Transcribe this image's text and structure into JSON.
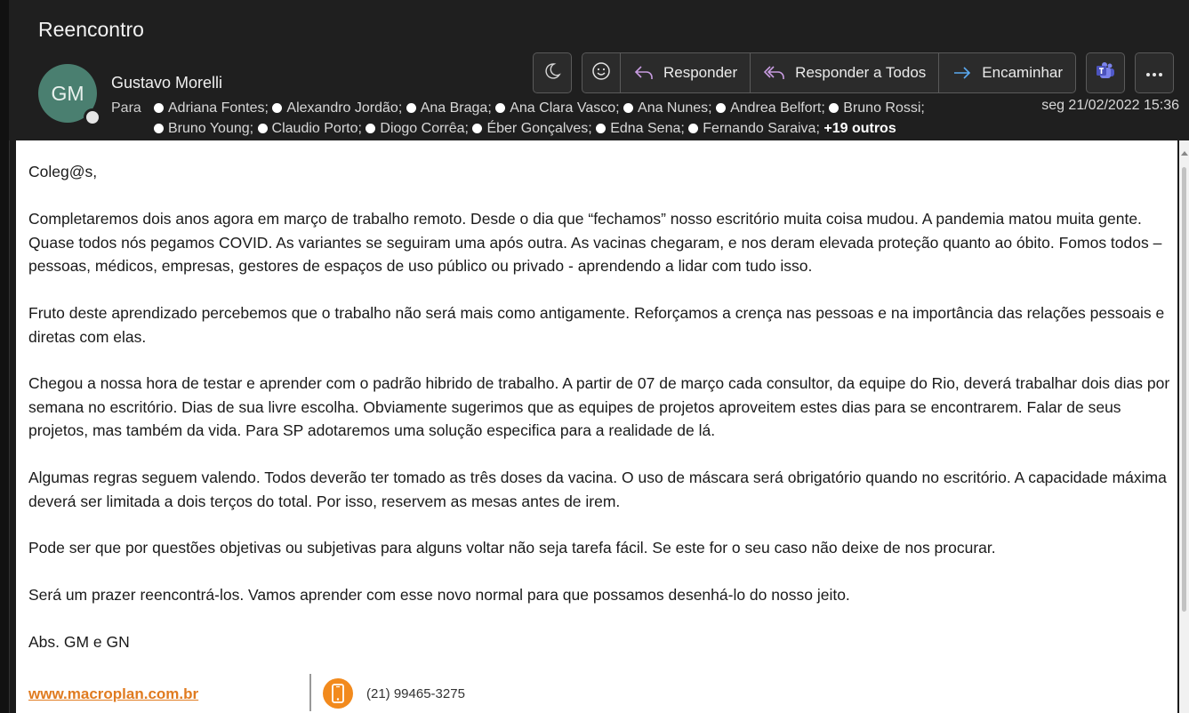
{
  "message": {
    "subject": "Reencontro",
    "avatar_initials": "GM",
    "sender": "Gustavo Morelli",
    "to_label": "Para",
    "recipients_line1": [
      "Adriana Fontes;",
      "Alexandro Jordão;",
      "Ana Braga;",
      "Ana Clara Vasco;",
      "Ana Nunes;",
      "Andrea Belfort;",
      "Bruno Rossi;"
    ],
    "recipients_line2": [
      "Bruno Young;",
      "Claudio Porto;",
      "Diogo Corrêa;",
      "Éber Gonçalves;",
      "Edna Sena;",
      "Fernando Saraiva;"
    ],
    "more_recipients": "+19 outros",
    "date": "seg 21/02/2022 15:36"
  },
  "toolbar": {
    "reply": "Responder",
    "reply_all": "Responder a Todos",
    "forward": "Encaminhar",
    "icons": [
      "moon-icon",
      "emoji-icon",
      "reply-icon",
      "reply-all-icon",
      "forward-icon",
      "teams-icon",
      "more-icon"
    ]
  },
  "body": {
    "greeting": "Coleg@s,",
    "p1": "Completaremos dois anos agora em março de trabalho remoto. Desde o dia que “fechamos” nosso escritório muita coisa mudou. A pandemia matou muita gente. Quase todos nós pegamos COVID. As variantes se seguiram uma após outra. As vacinas chegaram, e nos deram elevada proteção quanto ao óbito. Fomos todos – pessoas, médicos, empresas, gestores de espaços de uso público ou privado - aprendendo a lidar com tudo isso.",
    "p2": "Fruto deste aprendizado percebemos que o trabalho não será mais como antigamente. Reforçamos a crença nas pessoas e na importância das relações pessoais e diretas com elas.",
    "p3": "Chegou a nossa hora de testar e aprender com o padrão hibrido de trabalho. A partir de 07 de março cada consultor, da equipe do Rio, deverá trabalhar dois dias por semana no escritório. Dias de sua livre escolha. Obviamente sugerimos que as equipes de projetos aproveitem estes dias para se encontrarem. Falar de seus projetos, mas também da vida. Para SP adotaremos uma solução especifica para a realidade de lá.",
    "p4": "Algumas regras seguem valendo. Todos deverão ter tomado as três doses da vacina. O uso de máscara será obrigatório quando no escritório. A capacidade máxima deverá ser limitada a dois terços do total. Por isso, reservem as mesas antes de irem.",
    "p5": "Pode ser que por questões objetivas ou subjetivas para alguns voltar não seja tarefa fácil. Se este for o seu caso não deixe de nos procurar.",
    "p6": "Será um prazer reencontrá-los. Vamos aprender com esse novo normal para que possamos desenhá-lo do nosso jeito.",
    "signoff": "Abs. GM e GN"
  },
  "signature": {
    "website": "www.macroplan.com.br",
    "phone": "(21) 99465-3275"
  },
  "colors": {
    "accent_orange": "#f28a1d",
    "link_orange": "#e07b20",
    "avatar_green": "#4a7f70",
    "reply_purple": "#c79be0",
    "forward_blue": "#5aa9f0"
  }
}
